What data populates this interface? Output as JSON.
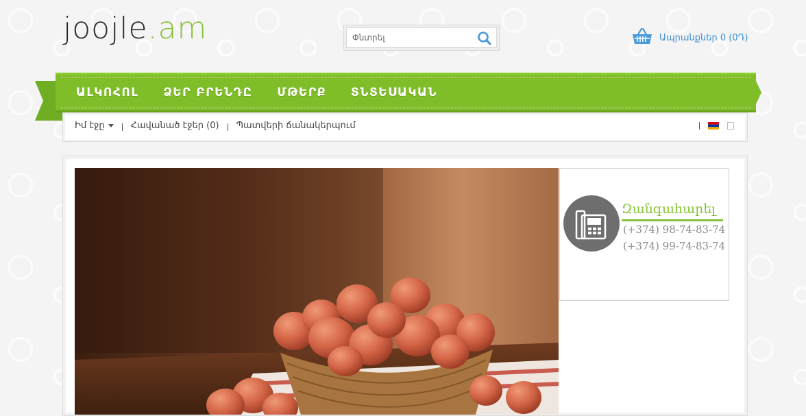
{
  "logo": {
    "prefix": "joojle",
    "dot": ".",
    "suffix": "am"
  },
  "search": {
    "placeholder": "Փնտրել"
  },
  "cart": {
    "label": "Ապրանքներ 0 (0Դ)"
  },
  "menu": {
    "items": [
      {
        "label": "ԱԼԿՈՀՈԼ"
      },
      {
        "label": "ՁԵՐ ԲՐԵՆԴԸ"
      },
      {
        "label": "ՄԹԵՐՔ"
      },
      {
        "label": "ՏՆՏԵՍԱԿԱՆ"
      }
    ]
  },
  "subbar": {
    "my_page": "Իմ էջը",
    "favorites": "Հավանած էջեր (0)",
    "order_history": "Պատվերի ճանակերպում"
  },
  "call": {
    "title": "Զանգահարել",
    "phone1": "(+374) 98-74-83-74",
    "phone2": "(+374) 99-74-83-74"
  },
  "colors": {
    "brand_green": "#86c235",
    "link_blue": "#3d8fd6"
  }
}
